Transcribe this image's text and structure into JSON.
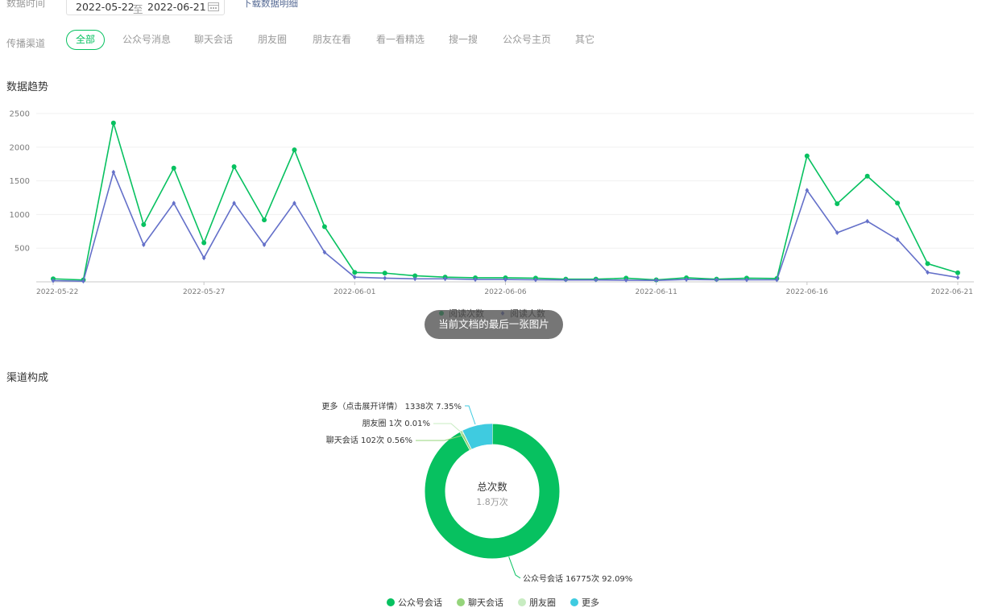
{
  "filters": {
    "date_label": "数据时间",
    "date_start": "2022-05-22",
    "date_sep": "至",
    "date_end": "2022-06-21",
    "download_link": "下载数据明细",
    "channel_label": "传播渠道",
    "tabs": [
      "全部",
      "公众号消息",
      "聊天会话",
      "朋友圈",
      "朋友在看",
      "看一看精选",
      "搜一搜",
      "公众号主页",
      "其它"
    ]
  },
  "trend": {
    "title": "数据趋势"
  },
  "composition": {
    "title": "渠道构成"
  },
  "toast": "当前文档的最后一张图片",
  "colors": {
    "green": "#07c160",
    "purple": "#6470c9",
    "light_green": "#95d47b",
    "pale_green": "#c8ecc2",
    "cyan": "#3fcbe0"
  },
  "chart_data": [
    {
      "type": "line",
      "x": [
        "2022-05-22",
        "2022-05-23",
        "2022-05-24",
        "2022-05-25",
        "2022-05-26",
        "2022-05-27",
        "2022-05-28",
        "2022-05-29",
        "2022-05-30",
        "2022-05-31",
        "2022-06-01",
        "2022-06-02",
        "2022-06-03",
        "2022-06-04",
        "2022-06-05",
        "2022-06-06",
        "2022-06-07",
        "2022-06-08",
        "2022-06-09",
        "2022-06-10",
        "2022-06-11",
        "2022-06-12",
        "2022-06-13",
        "2022-06-14",
        "2022-06-15",
        "2022-06-16",
        "2022-06-17",
        "2022-06-18",
        "2022-06-19",
        "2022-06-20",
        "2022-06-21"
      ],
      "x_ticks": [
        "2022-05-22",
        "2022-05-27",
        "2022-06-01",
        "2022-06-06",
        "2022-06-11",
        "2022-06-16",
        "2022-06-21"
      ],
      "ylim": [
        0,
        2500
      ],
      "y_ticks": [
        500,
        1000,
        1500,
        2000,
        2500
      ],
      "grid": true,
      "legend": "bottom-center",
      "series": [
        {
          "name": "阅读次数",
          "values": [
            45,
            28,
            2360,
            850,
            1690,
            580,
            1710,
            920,
            1960,
            820,
            140,
            130,
            90,
            70,
            60,
            60,
            55,
            40,
            40,
            55,
            30,
            60,
            40,
            55,
            50,
            1870,
            1160,
            1570,
            1170,
            270,
            135
          ]
        },
        {
          "name": "阅读人数",
          "values": [
            18,
            10,
            1630,
            550,
            1170,
            355,
            1170,
            550,
            1170,
            440,
            70,
            55,
            45,
            45,
            35,
            35,
            30,
            28,
            28,
            25,
            22,
            35,
            30,
            30,
            30,
            1360,
            730,
            900,
            630,
            140,
            65
          ]
        }
      ]
    },
    {
      "type": "pie",
      "donut": true,
      "center_title": "总次数",
      "center_value": "1.8万次",
      "slices": [
        {
          "name": "公众号会话",
          "label": "公众号会话 16775次 92.09%",
          "value": 16775,
          "percent": 92.09
        },
        {
          "name": "聊天会话",
          "label": "聊天会话 102次 0.56%",
          "value": 102,
          "percent": 0.56
        },
        {
          "name": "朋友圈",
          "label": "朋友圈 1次 0.01%",
          "value": 1,
          "percent": 0.01
        },
        {
          "name": "更多",
          "label": "更多（点击展开详情） 1338次 7.35%",
          "value": 1338,
          "percent": 7.35
        }
      ],
      "legend": "bottom-center"
    }
  ]
}
